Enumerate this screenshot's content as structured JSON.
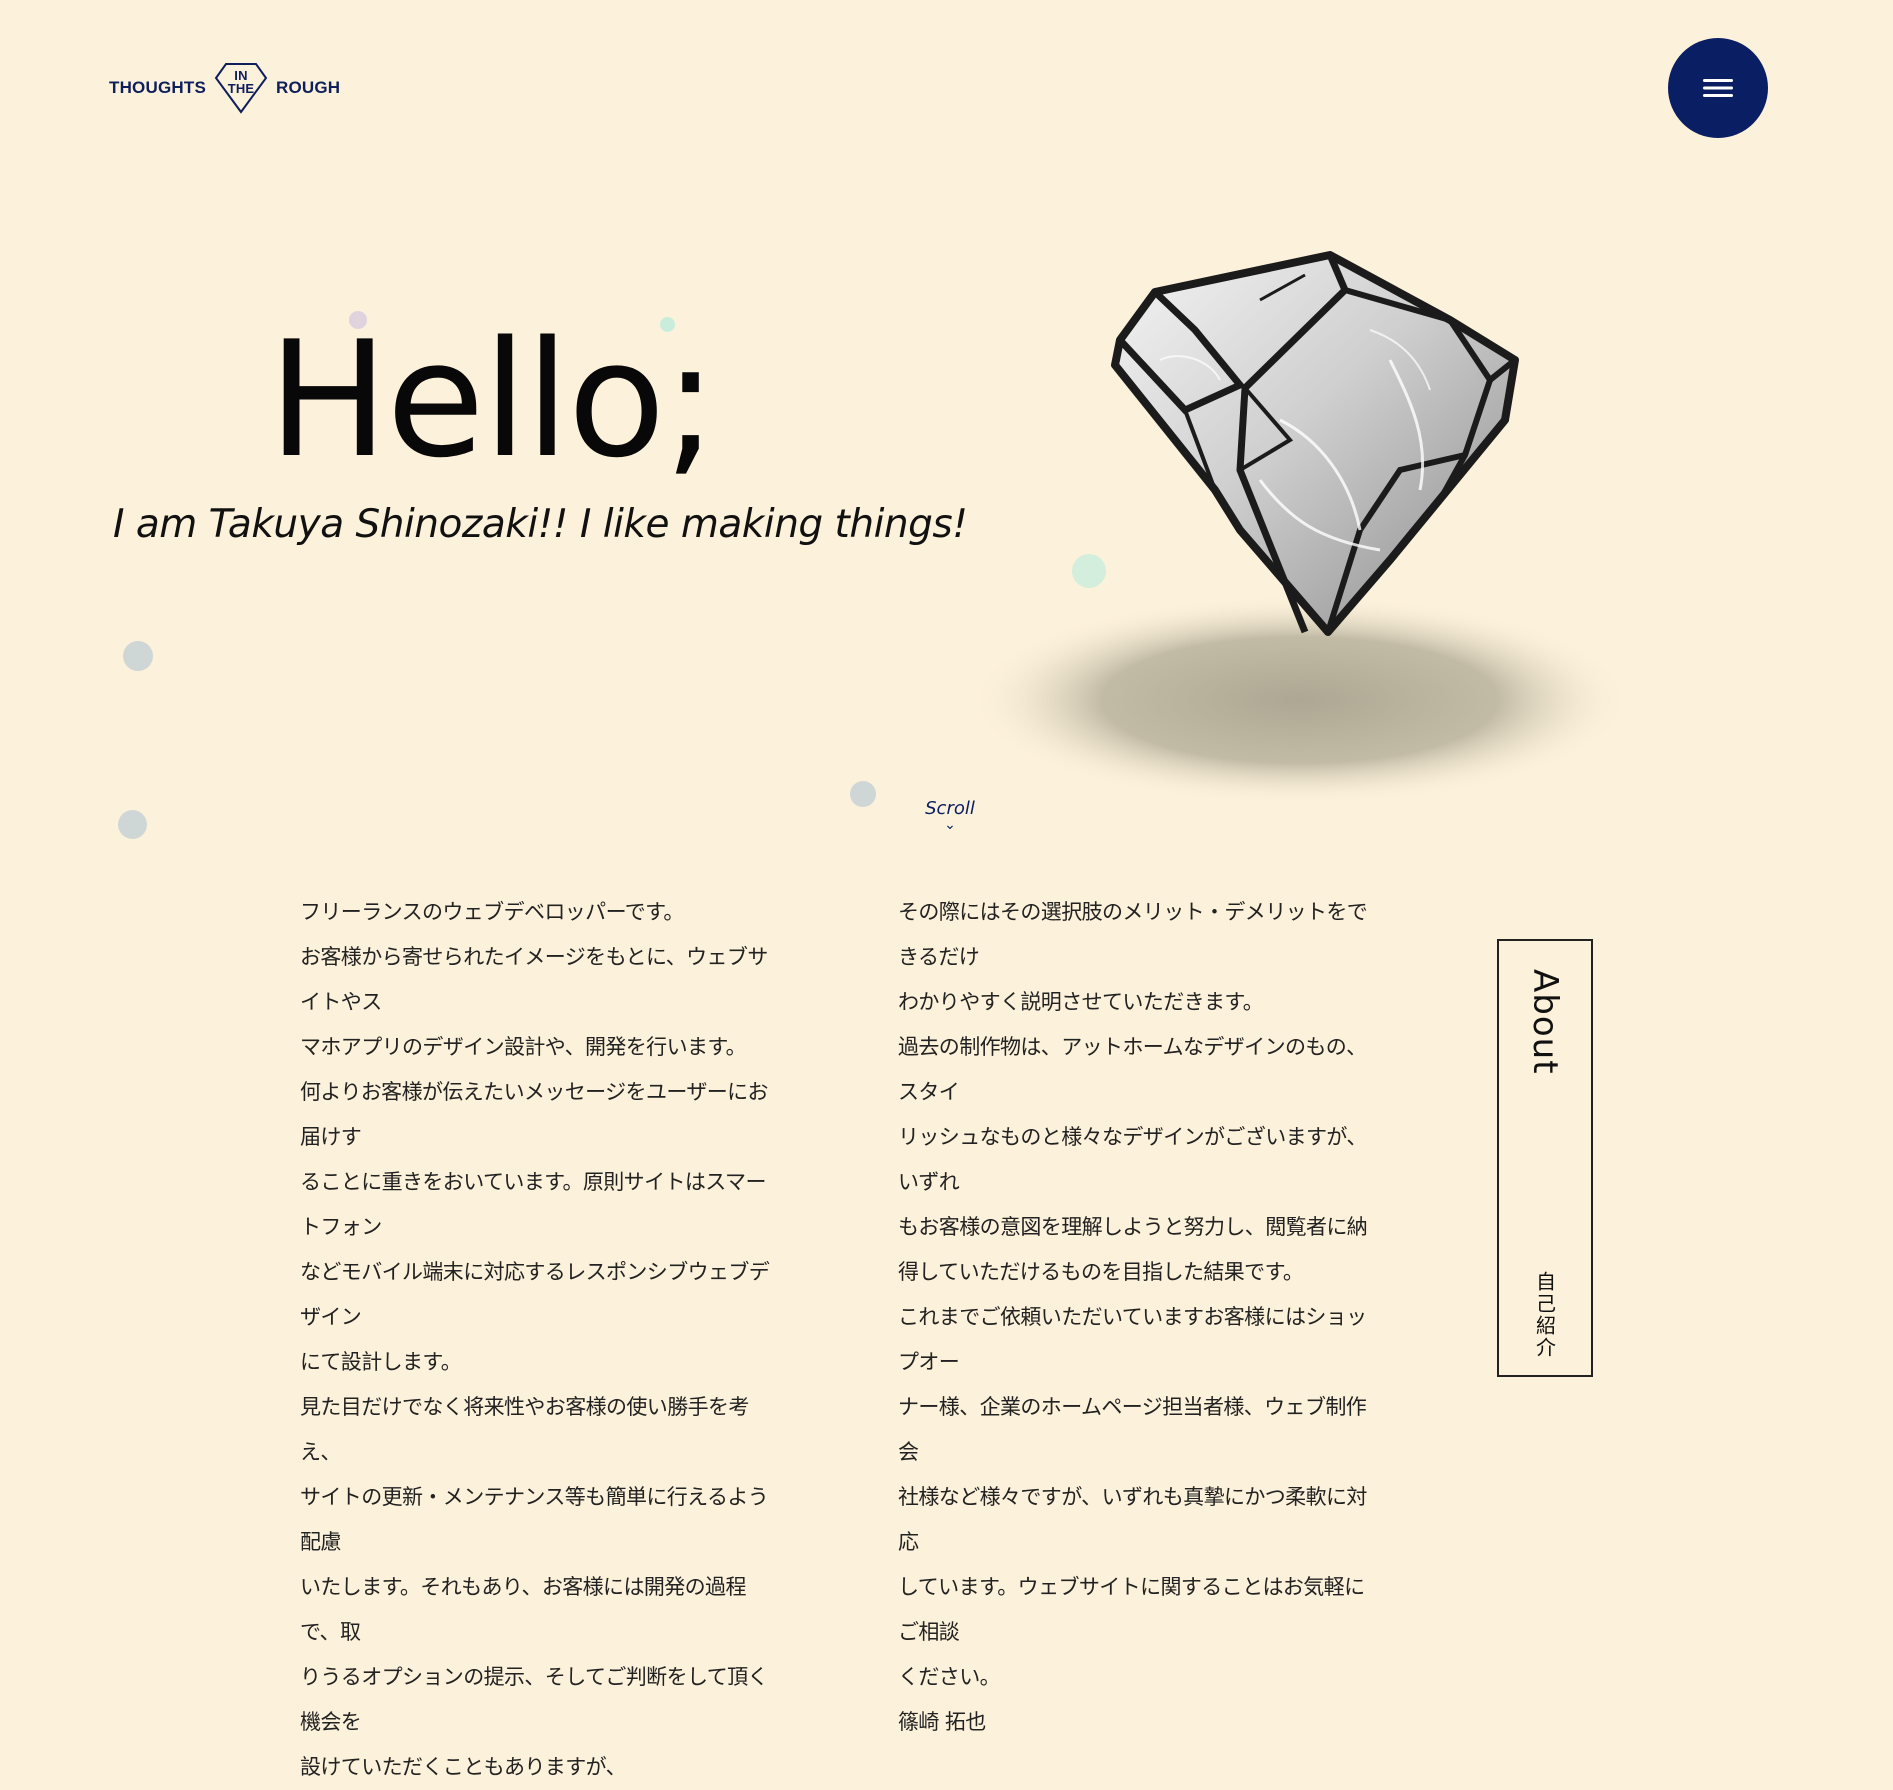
{
  "header": {
    "logo": {
      "left": "THOUGHTS",
      "mid_top": "IN",
      "mid_bottom": "THE",
      "right": "ROUGH"
    },
    "menu_icon": "hamburger-icon"
  },
  "hero": {
    "title": "Hello;",
    "tagline": "I am Takuya Shinozaki!! I like making things!",
    "image": "rough-gem-image"
  },
  "scroll": {
    "label": "Scroll",
    "icon": "chevron-down-icon"
  },
  "intro": {
    "column1": [
      "フリーランスのウェブデベロッパーです。",
      "お客様から寄せられたイメージをもとに、ウェブサイトやス",
      "マホアプリのデザイン設計や、開発を行います。",
      "何よりお客様が伝えたいメッセージをユーザーにお届けす",
      "ることに重きをおいています。原則サイトはスマートフォン",
      "などモバイル端末に対応するレスポンシブウェブデザイン",
      "にて設計します。",
      "見た目だけでなく将来性やお客様の使い勝手を考え、",
      "サイトの更新・メンテナンス等も簡単に行えるよう配慮",
      "いたします。それもあり、お客様には開発の過程で、取",
      "りうるオプションの提示、そしてご判断をして頂く機会を",
      "設けていただくこともありますが、"
    ],
    "column2": [
      "その際にはその選択肢のメリット・デメリットをできるだけ",
      "わかりやすく説明させていただきます。",
      "過去の制作物は、アットホームなデザインのもの、スタイ",
      "リッシュなものと様々なデザインがございますが、いずれ",
      "もお客様の意図を理解しようと努力し、閲覧者に納",
      "得していただけるものを目指した結果です。",
      "これまでご依頼いただいていますお客様にはショップオー",
      "ナー様、企業のホームページ担当者様、ウェブ制作会",
      "社様など様々ですが、いずれも真摯にかつ柔軟に対応",
      "しています。ウェブサイトに関することはお気軽にご相談",
      "ください。",
      "篠崎 拓也"
    ]
  },
  "about": {
    "title": "About",
    "subtitle": "自己紹介"
  },
  "colors": {
    "background": "#fcf1da",
    "accent": "#0a1f63",
    "text": "#1a1a1a"
  }
}
